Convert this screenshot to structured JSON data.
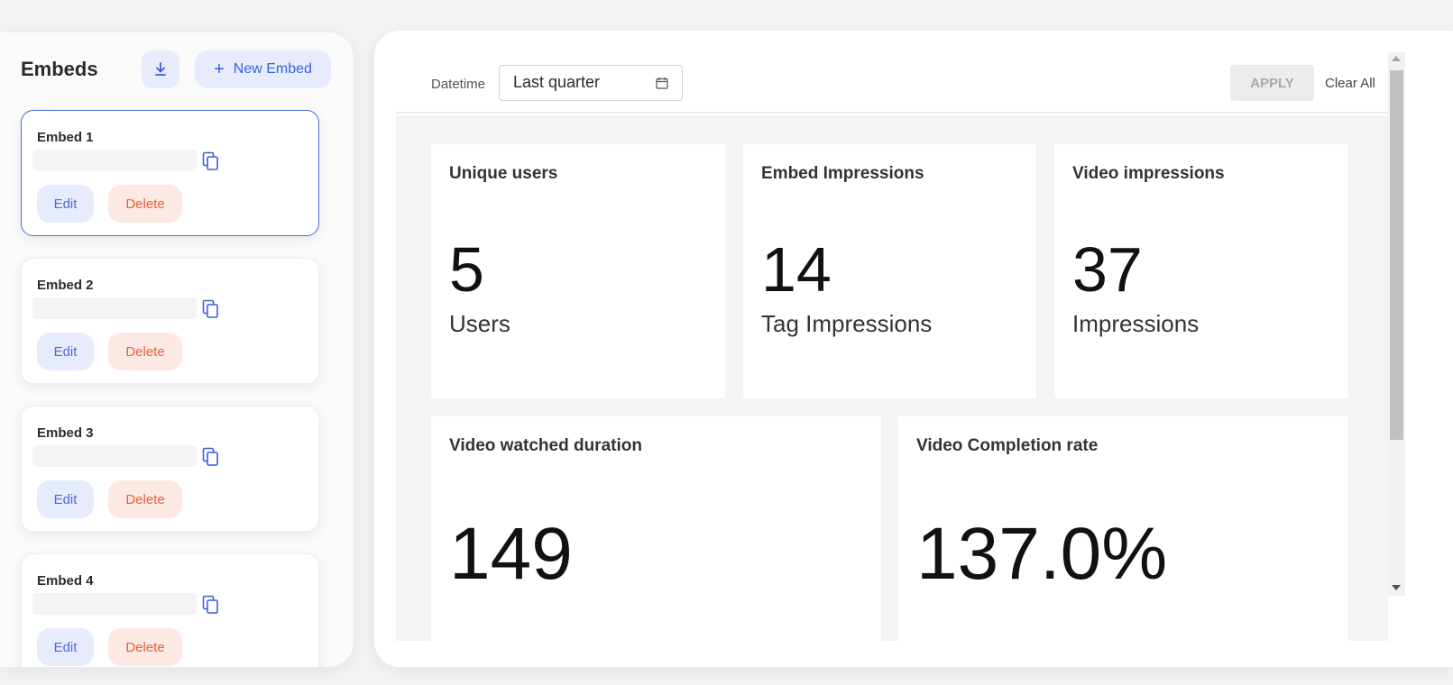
{
  "sidebar": {
    "title": "Embeds",
    "new_button_label": "New Embed",
    "embeds": [
      {
        "name": "Embed 1",
        "edit_label": "Edit",
        "delete_label": "Delete"
      },
      {
        "name": "Embed 2",
        "edit_label": "Edit",
        "delete_label": "Delete"
      },
      {
        "name": "Embed 3",
        "edit_label": "Edit",
        "delete_label": "Delete"
      },
      {
        "name": "Embed 4",
        "edit_label": "Edit",
        "delete_label": "Delete"
      }
    ]
  },
  "filters": {
    "datetime_label": "Datetime",
    "datetime_value": "Last quarter",
    "apply_label": "APPLY",
    "clear_label": "Clear All"
  },
  "metrics": [
    {
      "title": "Unique users",
      "value": "5",
      "unit": "Users"
    },
    {
      "title": "Embed Impressions",
      "value": "14",
      "unit": "Tag Impressions"
    },
    {
      "title": "Video impressions",
      "value": "37",
      "unit": "Impressions"
    },
    {
      "title": "Video watched duration",
      "value": "149",
      "unit": ""
    },
    {
      "title": "Video Completion rate",
      "value": "137.0%",
      "unit": ""
    }
  ],
  "colors": {
    "accent": "#3d5fd9",
    "danger": "#e8603c",
    "accent_bg": "#e6ecfc",
    "danger_bg": "#fde9e3"
  },
  "icons": {
    "download": "download-icon",
    "plus": "plus-icon",
    "copy": "copy-icon",
    "calendar": "calendar-icon"
  }
}
